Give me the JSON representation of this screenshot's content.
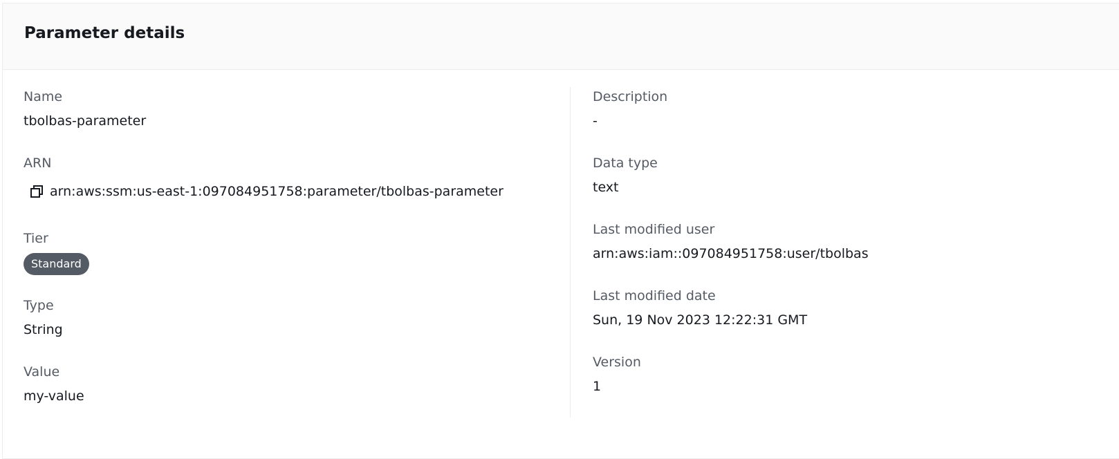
{
  "panel": {
    "title": "Parameter details"
  },
  "left": {
    "name": {
      "label": "Name",
      "value": "tbolbas-parameter"
    },
    "arn": {
      "label": "ARN",
      "value": "arn:aws:ssm:us-east-1:097084951758:parameter/tbolbas-parameter",
      "icon": "copy-icon"
    },
    "tier": {
      "label": "Tier",
      "value": "Standard",
      "badge_color": "#545b64"
    },
    "type": {
      "label": "Type",
      "value": "String"
    },
    "value": {
      "label": "Value",
      "value": "my-value"
    }
  },
  "right": {
    "description": {
      "label": "Description",
      "value": "-"
    },
    "data_type": {
      "label": "Data type",
      "value": "text"
    },
    "last_modified_user": {
      "label": "Last modified user",
      "value": "arn:aws:iam::097084951758:user/tbolbas"
    },
    "last_modified_date": {
      "label": "Last modified date",
      "value": "Sun, 19 Nov 2023 12:22:31 GMT"
    },
    "version": {
      "label": "Version",
      "value": "1"
    }
  }
}
